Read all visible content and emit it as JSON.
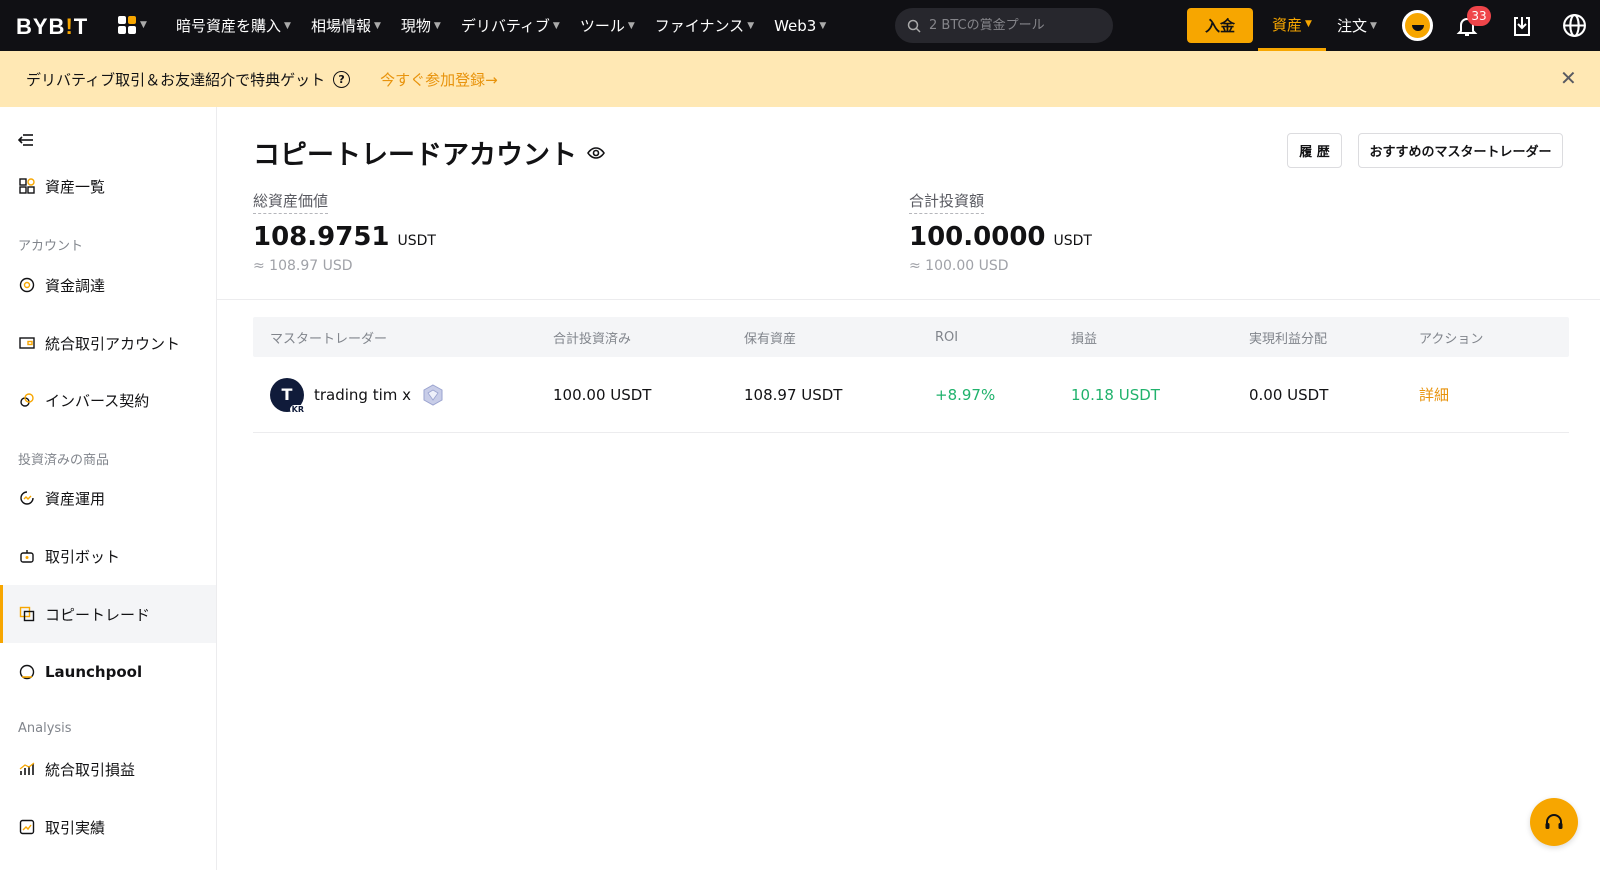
{
  "topbar": {
    "logo_main": "BYB",
    "logo_accent": "!",
    "logo_end": "T",
    "menu": [
      {
        "label": "暗号資産を購入"
      },
      {
        "label": "相場情報"
      },
      {
        "label": "現物"
      },
      {
        "label": "デリバティブ"
      },
      {
        "label": "ツール"
      },
      {
        "label": "ファイナンス"
      },
      {
        "label": "Web3"
      }
    ],
    "search_placeholder": "2 BTCの賞金プール",
    "deposit_label": "入金",
    "assets_label": "資産",
    "orders_label": "注文",
    "notification_count": "33",
    "accent_color": "#f7a600"
  },
  "banner": {
    "text": "デリバティブ取引＆お友達紹介で特典ゲット",
    "link": "今すぐ参加登録→",
    "close": "✕"
  },
  "sidebar": {
    "items": [
      {
        "label": "資産一覧",
        "icon": "grid-icon"
      },
      {
        "label": "資金調達",
        "icon": "coin-icon"
      },
      {
        "label": "統合取引アカウント",
        "icon": "wallet-icon"
      },
      {
        "label": "インバース契約",
        "icon": "link-icon"
      },
      {
        "label": "資産運用",
        "icon": "refresh-icon"
      },
      {
        "label": "取引ボット",
        "icon": "robot-icon"
      },
      {
        "label": "コピートレード",
        "icon": "copy-icon"
      },
      {
        "label": "Launchpool",
        "icon": "pool-icon"
      },
      {
        "label": "統合取引損益",
        "icon": "bar-chart-icon"
      },
      {
        "label": "取引実績",
        "icon": "trend-icon"
      }
    ],
    "sections": {
      "account": "アカウント",
      "invested": "投資済みの商品",
      "analysis": "Analysis"
    }
  },
  "main": {
    "title": "コピートレードアカウント",
    "history_button": "履 歴",
    "recommend_button": "おすすめのマスタートレーダー",
    "total_asset": {
      "label": "総資産価値",
      "value": "108.9751",
      "unit": "USDT",
      "approx": "≈ 108.97 USD"
    },
    "total_invest": {
      "label": "合計投資額",
      "value": "100.0000",
      "unit": "USDT",
      "approx": "≈ 100.00 USD"
    },
    "table": {
      "headers": [
        "マスタートレーダー",
        "合計投資済み",
        "保有資産",
        "ROI",
        "損益",
        "実現利益分配",
        "アクション"
      ],
      "rows": [
        {
          "trader": "trading tim x",
          "avatar_letter": "T",
          "avatar_badge": "KR",
          "invested": "100.00 USDT",
          "holding": "108.97 USDT",
          "roi": "+8.97%",
          "pnl": "10.18 USDT",
          "profit_share": "0.00 USDT",
          "action": "詳細"
        }
      ]
    }
  }
}
